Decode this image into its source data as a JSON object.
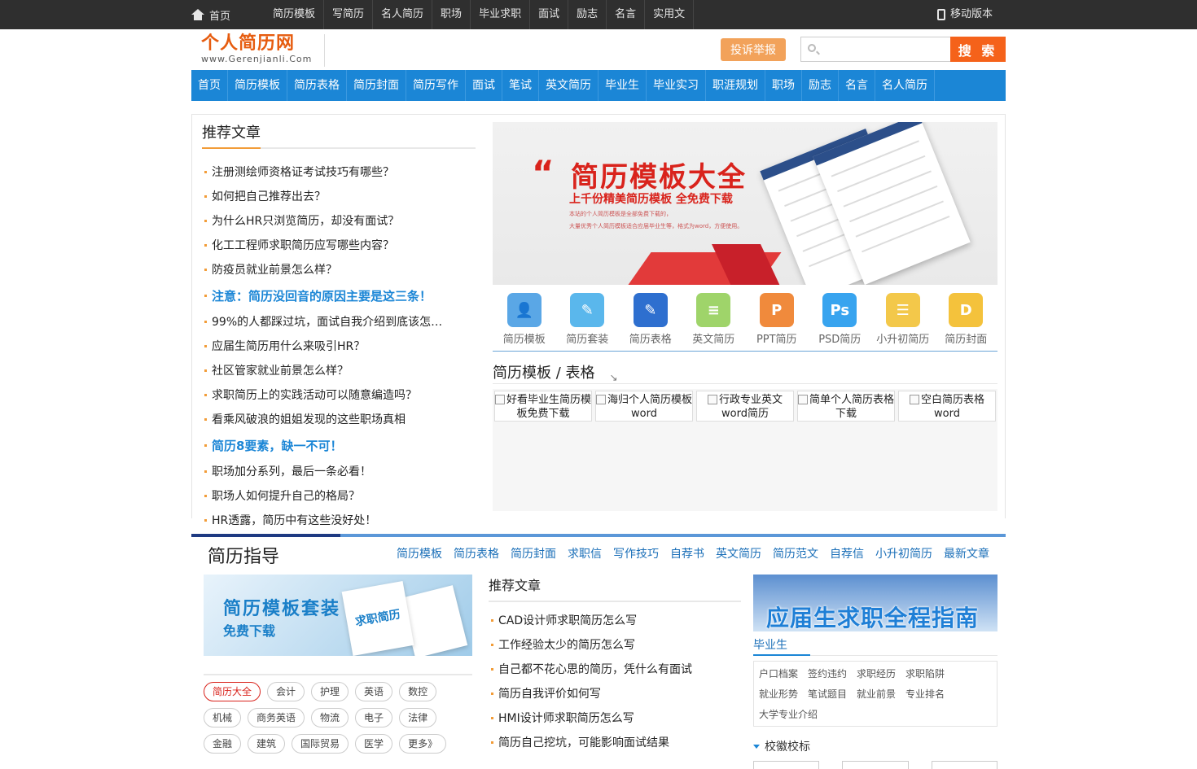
{
  "topbar": {
    "home": "首页",
    "items": [
      "简历模板",
      "写简历",
      "名人简历",
      "职场",
      "毕业求职",
      "面试",
      "励志",
      "名言",
      "实用文"
    ],
    "mobile": "移动版本"
  },
  "header": {
    "logo_title": "个人简历网",
    "logo_url": "www.Gerenjianli.Com",
    "report": "投诉举报",
    "search_placeholder": "",
    "search_button": "搜 索"
  },
  "mainnav": [
    "首页",
    "简历模板",
    "简历表格",
    "简历封面",
    "简历写作",
    "面试",
    "笔试",
    "英文简历",
    "毕业生",
    "毕业实习",
    "职涯规划",
    "职场",
    "励志",
    "名言",
    "名人简历"
  ],
  "recommended": {
    "title": "推荐文章",
    "items": [
      {
        "text": "注册测绘师资格证考试技巧有哪些？",
        "hl": false
      },
      {
        "text": "如何把自己推荐出去？",
        "hl": false
      },
      {
        "text": "为什么HR只浏览简历，却没有面试？",
        "hl": false
      },
      {
        "text": "化工工程师求职简历应写哪些内容？",
        "hl": false
      },
      {
        "text": "防疫员就业前景怎么样？",
        "hl": false
      },
      {
        "text": "注意：简历没回音的原因主要是这三条！",
        "hl": true
      },
      {
        "text": "99%的人都踩过坑，面试自我介绍到底该怎…",
        "hl": false
      },
      {
        "text": "应届生简历用什么来吸引HR？",
        "hl": false
      },
      {
        "text": "社区管家就业前景怎么样？",
        "hl": false
      },
      {
        "text": "求职简历上的实践活动可以随意编造吗？",
        "hl": false
      },
      {
        "text": "看乘风破浪的姐姐发现的这些职场真相",
        "hl": false
      },
      {
        "text": "简历8要素，缺一不可！",
        "hl": true
      },
      {
        "text": "职场加分系列，最后一条必看！",
        "hl": false
      },
      {
        "text": "职场人如何提升自己的格局？",
        "hl": false
      },
      {
        "text": "HR透露，简历中有这些没好处！",
        "hl": false
      }
    ]
  },
  "banner": {
    "quote": "“",
    "title": "简历模板大全",
    "subtitle": "上千份精美简历模板 全免费下载",
    "desc1": "本站的个人简历模板是全部免费下载的，",
    "desc2": "大量优秀个人简历模板适合应届毕业生等，格式为word，方便使用。"
  },
  "icon_links": [
    {
      "label": "简历模板",
      "name": "resume-template-icon",
      "color": "#5aa7e6",
      "glyph": "👤"
    },
    {
      "label": "简历套装",
      "name": "resume-pack-icon",
      "color": "#5ab7ec",
      "glyph": "✎"
    },
    {
      "label": "简历表格",
      "name": "resume-table-icon",
      "color": "#2e6fcf",
      "glyph": "✎"
    },
    {
      "label": "英文简历",
      "name": "english-resume-icon",
      "color": "#9fd46a",
      "glyph": "≡"
    },
    {
      "label": "PPT简历",
      "name": "ppt-resume-icon",
      "color": "#f08a3c",
      "glyph": "P"
    },
    {
      "label": "PSD简历",
      "name": "psd-resume-icon",
      "color": "#38a4ef",
      "glyph": "Ps"
    },
    {
      "label": "小升初简历",
      "name": "primary-resume-icon",
      "color": "#f3c84a",
      "glyph": "☰"
    },
    {
      "label": "简历封面",
      "name": "resume-cover-icon",
      "color": "#f4c23c",
      "glyph": "D"
    }
  ],
  "templates": {
    "title": "简历模板 / 表格",
    "items": [
      "好看毕业生简历模板免费下载",
      "海归个人简历模板word",
      "行政专业英文word简历",
      "简单个人简历表格下载",
      "空白简历表格word"
    ]
  },
  "guide": {
    "title": "简历指导",
    "links": [
      "简历模板",
      "简历表格",
      "简历封面",
      "求职信",
      "写作技巧",
      "自荐书",
      "英文简历",
      "简历范文",
      "自荐信",
      "小升初简历",
      "最新文章"
    ],
    "promo_title": "简历模板套装",
    "promo_sub": "免费下载",
    "promo_book": "求职简历",
    "tags": [
      {
        "text": "简历大全",
        "active": true
      },
      {
        "text": "会计",
        "active": false
      },
      {
        "text": "护理",
        "active": false
      },
      {
        "text": "英语",
        "active": false
      },
      {
        "text": "数控",
        "active": false
      },
      {
        "text": "机械",
        "active": false
      },
      {
        "text": "商务英语",
        "active": false
      },
      {
        "text": "物流",
        "active": false
      },
      {
        "text": "电子",
        "active": false
      },
      {
        "text": "法律",
        "active": false
      },
      {
        "text": "金融",
        "active": false
      },
      {
        "text": "建筑",
        "active": false
      },
      {
        "text": "国际贸易",
        "active": false
      },
      {
        "text": "医学",
        "active": false
      },
      {
        "text": "更多》",
        "active": false
      }
    ],
    "mid_title": "推荐文章",
    "mid_items": [
      "CAD设计师求职简历怎么写",
      "工作经验太少的简历怎么写",
      "自己都不花心思的简历，凭什么有面试",
      "简历自我评价如何写",
      "HMI设计师求职简历怎么写",
      "简历自己挖坑，可能影响面试结果"
    ],
    "grad_banner": "应届生求职全程指南",
    "grad_tab": "毕业生",
    "grad_links": [
      "户口档案",
      "签约违约",
      "求职经历",
      "求职陷阱",
      "就业形势",
      "笔试题目",
      "就业前景",
      "专业排名",
      "大学专业介绍"
    ],
    "school": "校徽校标"
  }
}
